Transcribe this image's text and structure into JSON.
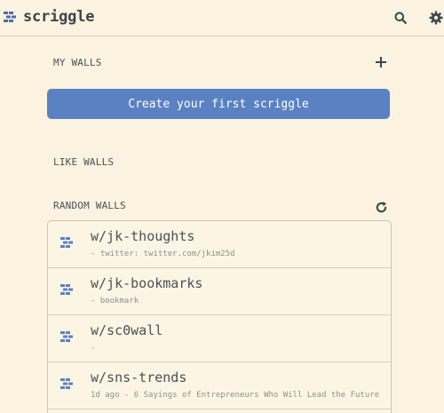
{
  "app": {
    "title": "scriggle"
  },
  "sections": {
    "my_walls": "MY WALLS",
    "like_walls": "LIKE WALLS",
    "random_walls": "RANDOM WALLS"
  },
  "create_button": {
    "label": "Create your first scriggle"
  },
  "random_walls": [
    {
      "name": "w/jk-thoughts",
      "desc": "- twitter: twitter.com/jkim25d"
    },
    {
      "name": "w/jk-bookmarks",
      "desc": "- bookmark"
    },
    {
      "name": "w/sc0wall",
      "desc": "-"
    },
    {
      "name": "w/sns-trends",
      "desc": "1d ago - 6 Sayings of Entrepreneurs Who Will Lead the Future"
    }
  ],
  "icons": {
    "logo": "brick-wall-icon",
    "search": "search-icon",
    "settings": "gear-icon",
    "add": "plus-icon",
    "refresh": "refresh-icon",
    "wall": "brick-wall-icon"
  },
  "colors": {
    "background": "#fbf3df",
    "accent": "#5a82c2",
    "text": "#4b4f57",
    "muted": "#8a8e95"
  }
}
